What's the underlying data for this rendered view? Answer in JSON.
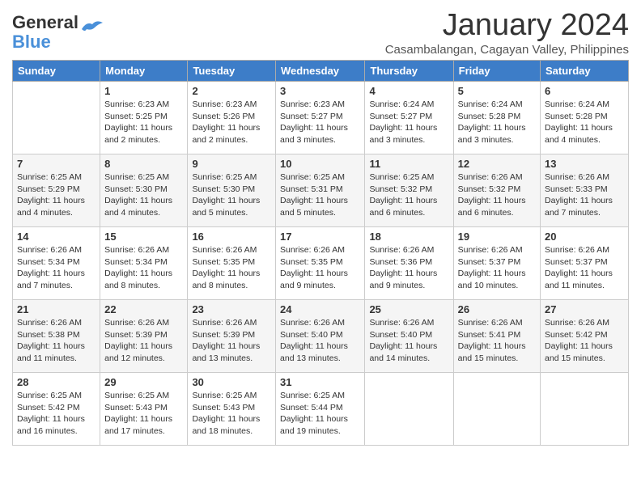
{
  "logo": {
    "text_general": "General",
    "text_blue": "Blue"
  },
  "header": {
    "month": "January 2024",
    "location": "Casambalangan, Cagayan Valley, Philippines"
  },
  "days_of_week": [
    "Sunday",
    "Monday",
    "Tuesday",
    "Wednesday",
    "Thursday",
    "Friday",
    "Saturday"
  ],
  "weeks": [
    [
      {
        "day": "",
        "info": ""
      },
      {
        "day": "1",
        "info": "Sunrise: 6:23 AM\nSunset: 5:25 PM\nDaylight: 11 hours\nand 2 minutes."
      },
      {
        "day": "2",
        "info": "Sunrise: 6:23 AM\nSunset: 5:26 PM\nDaylight: 11 hours\nand 2 minutes."
      },
      {
        "day": "3",
        "info": "Sunrise: 6:23 AM\nSunset: 5:27 PM\nDaylight: 11 hours\nand 3 minutes."
      },
      {
        "day": "4",
        "info": "Sunrise: 6:24 AM\nSunset: 5:27 PM\nDaylight: 11 hours\nand 3 minutes."
      },
      {
        "day": "5",
        "info": "Sunrise: 6:24 AM\nSunset: 5:28 PM\nDaylight: 11 hours\nand 3 minutes."
      },
      {
        "day": "6",
        "info": "Sunrise: 6:24 AM\nSunset: 5:28 PM\nDaylight: 11 hours\nand 4 minutes."
      }
    ],
    [
      {
        "day": "7",
        "info": "Sunrise: 6:25 AM\nSunset: 5:29 PM\nDaylight: 11 hours\nand 4 minutes."
      },
      {
        "day": "8",
        "info": "Sunrise: 6:25 AM\nSunset: 5:30 PM\nDaylight: 11 hours\nand 4 minutes."
      },
      {
        "day": "9",
        "info": "Sunrise: 6:25 AM\nSunset: 5:30 PM\nDaylight: 11 hours\nand 5 minutes."
      },
      {
        "day": "10",
        "info": "Sunrise: 6:25 AM\nSunset: 5:31 PM\nDaylight: 11 hours\nand 5 minutes."
      },
      {
        "day": "11",
        "info": "Sunrise: 6:25 AM\nSunset: 5:32 PM\nDaylight: 11 hours\nand 6 minutes."
      },
      {
        "day": "12",
        "info": "Sunrise: 6:26 AM\nSunset: 5:32 PM\nDaylight: 11 hours\nand 6 minutes."
      },
      {
        "day": "13",
        "info": "Sunrise: 6:26 AM\nSunset: 5:33 PM\nDaylight: 11 hours\nand 7 minutes."
      }
    ],
    [
      {
        "day": "14",
        "info": "Sunrise: 6:26 AM\nSunset: 5:34 PM\nDaylight: 11 hours\nand 7 minutes."
      },
      {
        "day": "15",
        "info": "Sunrise: 6:26 AM\nSunset: 5:34 PM\nDaylight: 11 hours\nand 8 minutes."
      },
      {
        "day": "16",
        "info": "Sunrise: 6:26 AM\nSunset: 5:35 PM\nDaylight: 11 hours\nand 8 minutes."
      },
      {
        "day": "17",
        "info": "Sunrise: 6:26 AM\nSunset: 5:35 PM\nDaylight: 11 hours\nand 9 minutes."
      },
      {
        "day": "18",
        "info": "Sunrise: 6:26 AM\nSunset: 5:36 PM\nDaylight: 11 hours\nand 9 minutes."
      },
      {
        "day": "19",
        "info": "Sunrise: 6:26 AM\nSunset: 5:37 PM\nDaylight: 11 hours\nand 10 minutes."
      },
      {
        "day": "20",
        "info": "Sunrise: 6:26 AM\nSunset: 5:37 PM\nDaylight: 11 hours\nand 11 minutes."
      }
    ],
    [
      {
        "day": "21",
        "info": "Sunrise: 6:26 AM\nSunset: 5:38 PM\nDaylight: 11 hours\nand 11 minutes."
      },
      {
        "day": "22",
        "info": "Sunrise: 6:26 AM\nSunset: 5:39 PM\nDaylight: 11 hours\nand 12 minutes."
      },
      {
        "day": "23",
        "info": "Sunrise: 6:26 AM\nSunset: 5:39 PM\nDaylight: 11 hours\nand 13 minutes."
      },
      {
        "day": "24",
        "info": "Sunrise: 6:26 AM\nSunset: 5:40 PM\nDaylight: 11 hours\nand 13 minutes."
      },
      {
        "day": "25",
        "info": "Sunrise: 6:26 AM\nSunset: 5:40 PM\nDaylight: 11 hours\nand 14 minutes."
      },
      {
        "day": "26",
        "info": "Sunrise: 6:26 AM\nSunset: 5:41 PM\nDaylight: 11 hours\nand 15 minutes."
      },
      {
        "day": "27",
        "info": "Sunrise: 6:26 AM\nSunset: 5:42 PM\nDaylight: 11 hours\nand 15 minutes."
      }
    ],
    [
      {
        "day": "28",
        "info": "Sunrise: 6:25 AM\nSunset: 5:42 PM\nDaylight: 11 hours\nand 16 minutes."
      },
      {
        "day": "29",
        "info": "Sunrise: 6:25 AM\nSunset: 5:43 PM\nDaylight: 11 hours\nand 17 minutes."
      },
      {
        "day": "30",
        "info": "Sunrise: 6:25 AM\nSunset: 5:43 PM\nDaylight: 11 hours\nand 18 minutes."
      },
      {
        "day": "31",
        "info": "Sunrise: 6:25 AM\nSunset: 5:44 PM\nDaylight: 11 hours\nand 19 minutes."
      },
      {
        "day": "",
        "info": ""
      },
      {
        "day": "",
        "info": ""
      },
      {
        "day": "",
        "info": ""
      }
    ]
  ]
}
